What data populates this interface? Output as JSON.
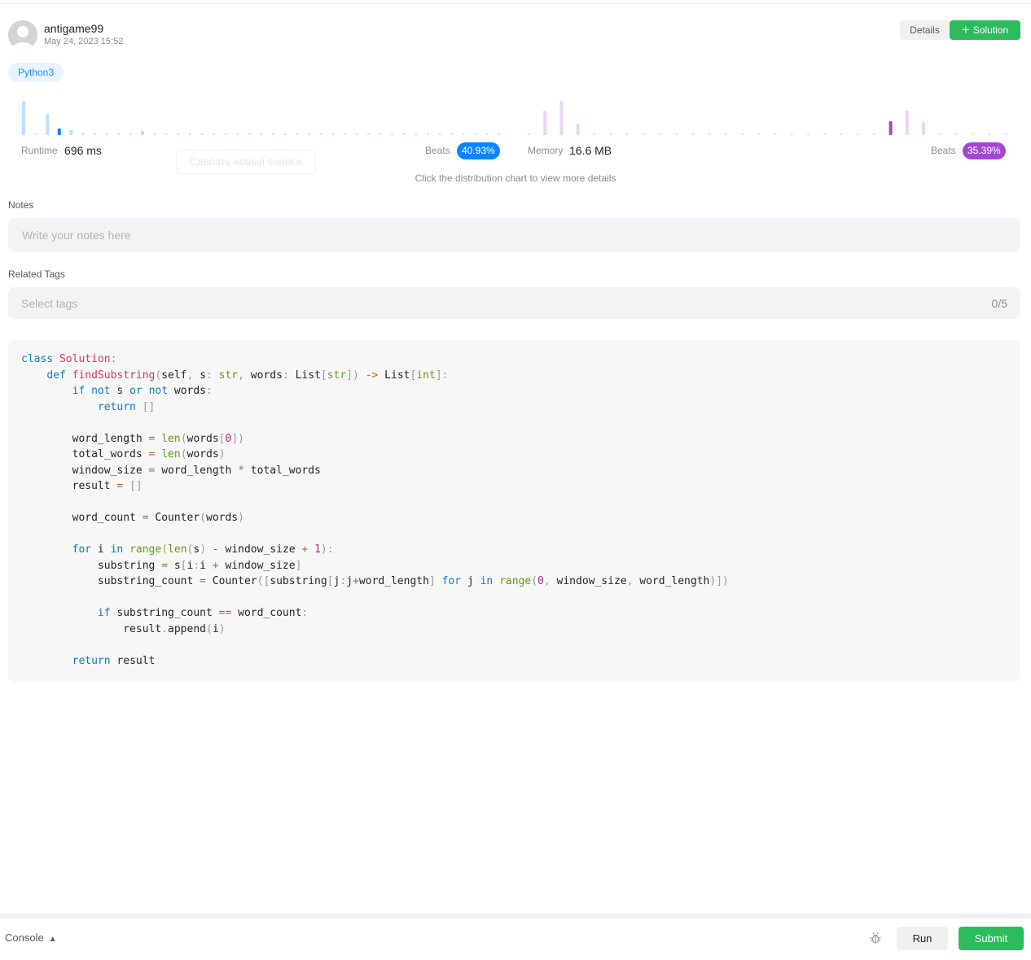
{
  "header": {
    "username": "antigame99",
    "date": "May 24, 2023 15:52",
    "details_label": "Details",
    "solution_label": "Solution"
  },
  "language": "Python3",
  "runtime": {
    "label": "Runtime",
    "value": "696 ms",
    "beats_label": "Beats",
    "beats": "40.93%",
    "chart": {
      "type": "bar",
      "bar_heights": [
        42,
        2,
        26,
        8,
        6,
        3,
        2,
        2,
        2,
        2,
        5,
        2,
        2,
        2,
        2,
        2,
        2,
        2,
        2,
        2,
        2,
        2,
        2,
        2,
        2,
        2,
        2,
        2,
        2,
        2,
        2,
        2,
        2,
        2,
        2,
        2,
        2,
        2,
        2,
        2,
        2
      ],
      "highlight_index": 3,
      "color": "#bfe1ff",
      "highlight_color": "#0a84ff"
    }
  },
  "memory": {
    "label": "Memory",
    "value": "16.6 MB",
    "beats_label": "Beats",
    "beats": "35.39%",
    "chart": {
      "type": "bar",
      "bar_heights": [
        2,
        30,
        42,
        14,
        2,
        2,
        2,
        2,
        2,
        2,
        2,
        2,
        2,
        2,
        2,
        2,
        2,
        2,
        2,
        2,
        2,
        2,
        17,
        30,
        16,
        2,
        2,
        2,
        2,
        2
      ],
      "highlight_index": 22,
      "color": "#ecd2f5",
      "highlight_color": "#a347d1"
    }
  },
  "ghost_tooltip": "Сделать новый снимок",
  "chart_hint": "Click the distribution chart to view more details",
  "notes": {
    "label": "Notes",
    "placeholder": "Write your notes here"
  },
  "tags": {
    "label": "Related Tags",
    "placeholder": "Select tags",
    "count": "0/5"
  },
  "code": "class Solution:\n    def findSubstring(self, s: str, words: List[str]) -> List[int]:\n        if not s or not words:\n            return []\n\n        word_length = len(words[0])\n        total_words = len(words)\n        window_size = word_length * total_words\n        result = []\n\n        word_count = Counter(words)\n\n        for i in range(len(s) - window_size + 1):\n            substring = s[i:i + window_size]\n            substring_count = Counter([substring[j:j+word_length] for j in range(0, window_size, word_length)])\n\n            if substring_count == word_count:\n                result.append(i)\n\n        return result",
  "console": {
    "label": "Console",
    "run_label": "Run",
    "submit_label": "Submit"
  }
}
